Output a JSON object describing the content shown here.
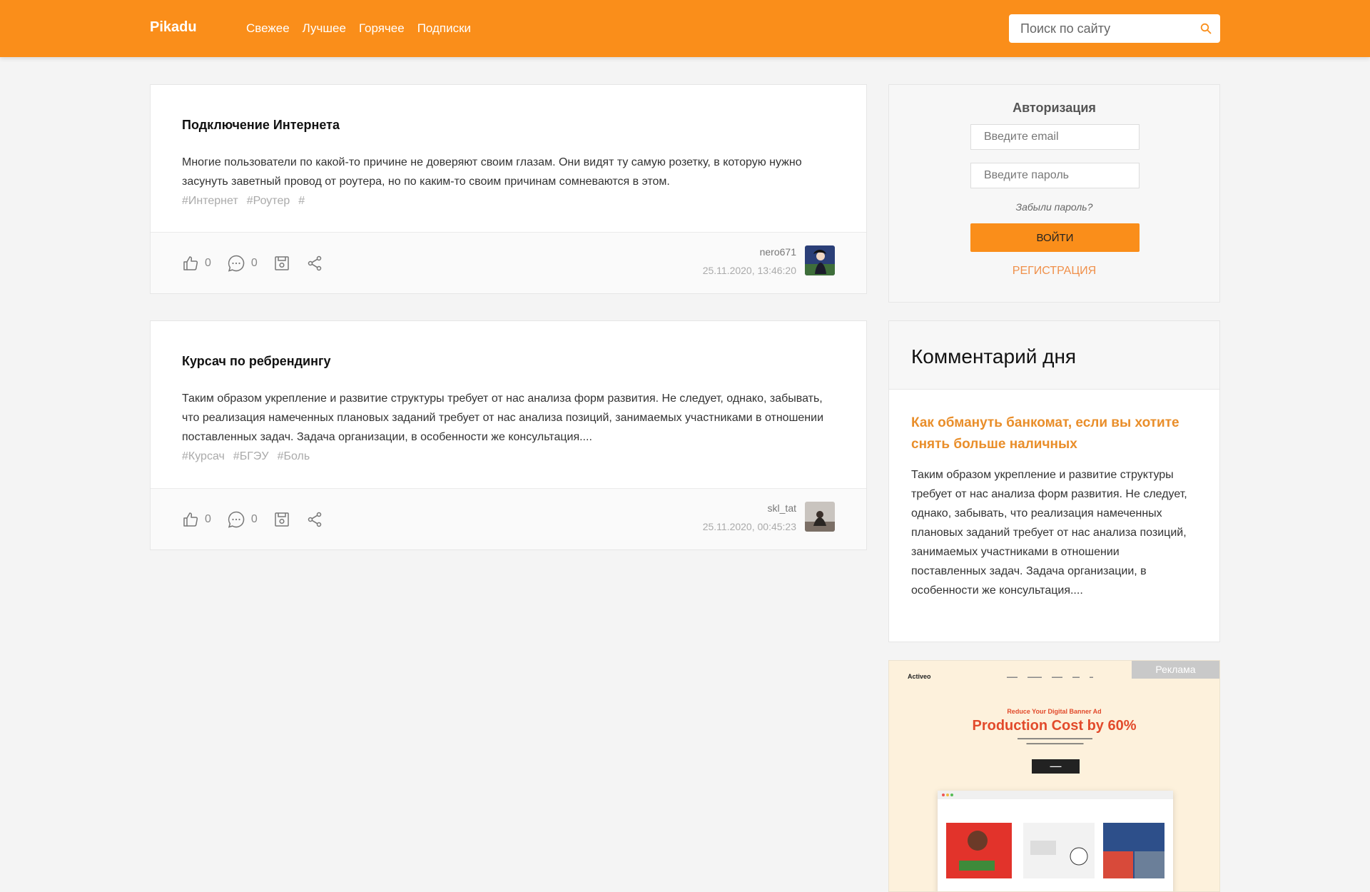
{
  "header": {
    "logo": "Pikadu",
    "nav": [
      "Свежее",
      "Лучшее",
      "Горячее",
      "Подписки"
    ],
    "search_placeholder": "Поиск по сайту"
  },
  "posts": [
    {
      "title": "Подключение Интернета",
      "text": "Многие пользователи по какой-то причине не доверяют своим глазам. Они видят ту самую розетку, в которую нужно засунуть заветный провод от роутера, но по каким-то своим причинам сомневаются в этом.",
      "tags": [
        "#Интернет",
        "#Роутер",
        "#"
      ],
      "likes": "0",
      "comments": "0",
      "author": "nero671",
      "date": "25.11.2020, 13:46:20"
    },
    {
      "title": "Курсач по ребрендингу",
      "text": "Таким образом укрепление и развитие структуры требует от нас анализа форм развития. Не следует, однако, забывать, что реализация намеченных плановых заданий требует от нас анализа позиций, занимаемых участниками в отношении поставленных задач. Задача организации, в особенности же консультация....",
      "tags": [
        "#Курсач",
        "#БГЭУ",
        "#Боль"
      ],
      "likes": "0",
      "comments": "0",
      "author": "skl_tat",
      "date": "25.11.2020, 00:45:23"
    }
  ],
  "auth": {
    "title": "Авторизация",
    "email_placeholder": "Введите email",
    "password_placeholder": "Введите пароль",
    "forgot": "Забыли пароль?",
    "login": "ВОЙТИ",
    "register": "РЕГИСТРАЦИЯ"
  },
  "comment_of_day": {
    "heading": "Комментарий дня",
    "link": "Как обмануть банкомат, если вы хотите снять больше наличных",
    "text": "Таким образом укрепление и развитие структуры требует от нас анализа форм развития. Не следует, однако, забывать, что реализация намеченных плановых заданий требует от нас анализа позиций, занимаемых участниками в отношении поставленных задач. Задача организации, в особенности же консультация...."
  },
  "ad": {
    "label": "Реклама",
    "logo": "Activeo",
    "sub": "Reduce Your Digital Banner Ad",
    "headline": "Production Cost by 60%"
  },
  "colors": {
    "brand": "#fa8e1a",
    "link": "#e98e2a"
  }
}
